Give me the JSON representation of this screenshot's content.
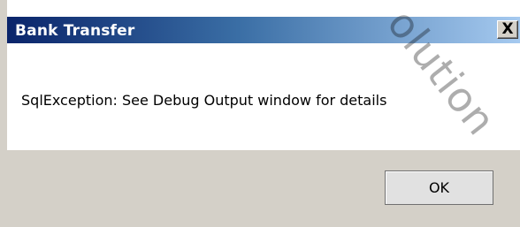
{
  "dialog": {
    "title": "Bank Transfer",
    "close_label": "X",
    "message": "SqlException: See Debug Output window for details",
    "ok_label": "OK"
  },
  "watermark": {
    "text": "olution"
  }
}
